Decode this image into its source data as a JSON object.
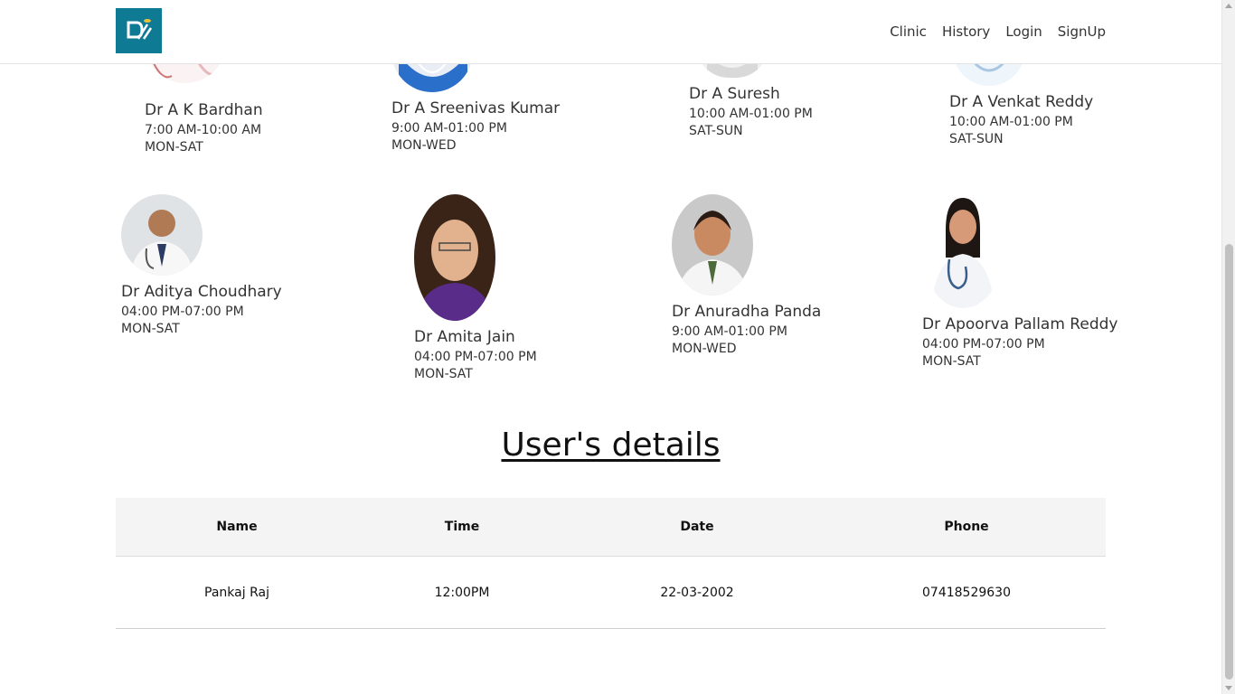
{
  "nav": {
    "logo_alt": "Clinic logo",
    "links": [
      "Clinic",
      "History",
      "Login",
      "SignUp"
    ]
  },
  "doctors_top": [
    {
      "name": "Dr A K Bardhan",
      "time": "7:00 AM-10:00 AM",
      "days": "MON-SAT"
    },
    {
      "name": "Dr A Sreenivas Kumar",
      "time": "9:00 AM-01:00 PM",
      "days": "MON-WED"
    },
    {
      "name": "Dr A Suresh",
      "time": "10:00 AM-01:00 PM",
      "days": "SAT-SUN"
    },
    {
      "name": "Dr A Venkat Reddy",
      "time": "10:00 AM-01:00 PM",
      "days": "SAT-SUN"
    }
  ],
  "doctors_bottom": [
    {
      "name": "Dr Aditya Choudhary",
      "time": "04:00 PM-07:00 PM",
      "days": "MON-SAT"
    },
    {
      "name": "Dr Amita Jain",
      "time": "04:00 PM-07:00 PM",
      "days": "MON-SAT"
    },
    {
      "name": "Dr Anuradha Panda",
      "time": "9:00 AM-01:00 PM",
      "days": "MON-WED"
    },
    {
      "name": "Dr Apoorva Pallam Reddy",
      "time": "04:00 PM-07:00 PM",
      "days": "MON-SAT"
    }
  ],
  "user_details": {
    "heading": "User's details",
    "columns": [
      "Name",
      "Time",
      "Date",
      "Phone"
    ],
    "rows": [
      [
        "Pankaj Raj",
        "12:00PM",
        "22-03-2002",
        "07418529630"
      ]
    ]
  },
  "colors": {
    "logo_bg": "#0e7a93",
    "header_bg": "#f4f4f4"
  }
}
